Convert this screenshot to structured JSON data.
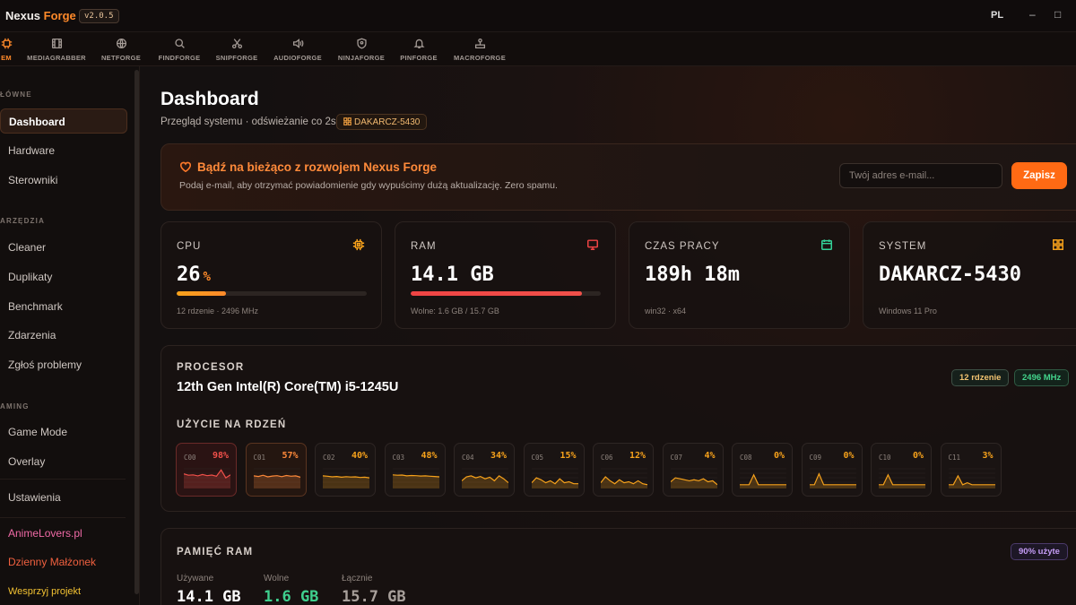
{
  "app": {
    "brand_main": "Nexus",
    "brand_accent": "Forge",
    "version": "v2.0.5",
    "lang": "PL",
    "minimize": "–",
    "maximize": "□"
  },
  "tools": [
    {
      "label": "EM",
      "icon": "chip-icon",
      "active": true
    },
    {
      "label": "MEDIAGRABBER",
      "icon": "film-icon"
    },
    {
      "label": "NETFORGE",
      "icon": "globe-icon"
    },
    {
      "label": "FINDFORGE",
      "icon": "search-icon"
    },
    {
      "label": "SNIPFORGE",
      "icon": "scissors-icon"
    },
    {
      "label": "AUDIOFORGE",
      "icon": "speaker-icon"
    },
    {
      "label": "NINJAFORGE",
      "icon": "shield-icon"
    },
    {
      "label": "PINFORGE",
      "icon": "bell-icon"
    },
    {
      "label": "MACROFORGE",
      "icon": "joystick-icon"
    }
  ],
  "sidebar": {
    "section_main": "ŁÓWNE",
    "section_tools": "ARZĘDZIA",
    "section_gaming": "AMING",
    "items_main": [
      "Dashboard",
      "Hardware",
      "Sterowniki"
    ],
    "items_tools": [
      "Cleaner",
      "Duplikaty",
      "Benchmark",
      "Zdarzenia",
      "Zgłoś problemy"
    ],
    "items_gaming": [
      "Game Mode",
      "Overlay"
    ],
    "settings": "Ustawienia",
    "link_anime": "AnimeLovers.pl",
    "link_dziennik": "Dzienny Małżonek",
    "link_support": "Wesprzyj projekt"
  },
  "page": {
    "title": "Dashboard",
    "subtitle": "Przegląd systemu · odświeżanie co 2s",
    "host": "DAKARCZ-5430"
  },
  "news": {
    "title": "Bądź na bieżąco z rozwojem Nexus Forge",
    "desc": "Podaj e-mail, aby otrzymać powiadomienie gdy wypuścimy dużą aktualizację. Zero spamu.",
    "email_placeholder": "Twój adres e-mail...",
    "subscribe": "Zapisz"
  },
  "stats": {
    "cpu": {
      "label": "CPU",
      "value": "26",
      "unit": "%",
      "sub": "12 rdzenie · 2496 MHz",
      "percent": 26,
      "color": "#f7a21b"
    },
    "ram": {
      "label": "RAM",
      "value": "14.1 GB",
      "sub": "Wolne: 1.6 GB / 15.7 GB",
      "percent": 90,
      "color": "#ef4444"
    },
    "uptime": {
      "label": "CZAS PRACY",
      "value": "189h 18m",
      "sub": "win32 · x64"
    },
    "system": {
      "label": "SYSTEM",
      "value": "DAKARCZ-5430",
      "sub": "Windows 11 Pro"
    }
  },
  "cpu": {
    "section": "PROCESOR",
    "name": "12th Gen Intel(R) Core(TM) i5-1245U",
    "cores_badge": "12 rdzenie",
    "mhz_badge": "2496 MHz",
    "usage_title": "UŻYCIE NA RDZEŃ",
    "cores": [
      {
        "id": "C00",
        "pct": "98%"
      },
      {
        "id": "C01",
        "pct": "57%"
      },
      {
        "id": "C02",
        "pct": "40%"
      },
      {
        "id": "C03",
        "pct": "48%"
      },
      {
        "id": "C04",
        "pct": "34%"
      },
      {
        "id": "C05",
        "pct": "15%"
      },
      {
        "id": "C06",
        "pct": "12%"
      },
      {
        "id": "C07",
        "pct": "4%"
      },
      {
        "id": "C08",
        "pct": "0%"
      },
      {
        "id": "C09",
        "pct": "0%"
      },
      {
        "id": "C10",
        "pct": "0%"
      },
      {
        "id": "C11",
        "pct": "3%"
      }
    ]
  },
  "ram": {
    "section": "PAMIĘĆ RAM",
    "badge": "90% użyte",
    "used_label": "Używane",
    "used": "14.1 GB",
    "free_label": "Wolne",
    "free": "1.6 GB",
    "total_label": "Łącznie",
    "total": "15.7 GB"
  }
}
